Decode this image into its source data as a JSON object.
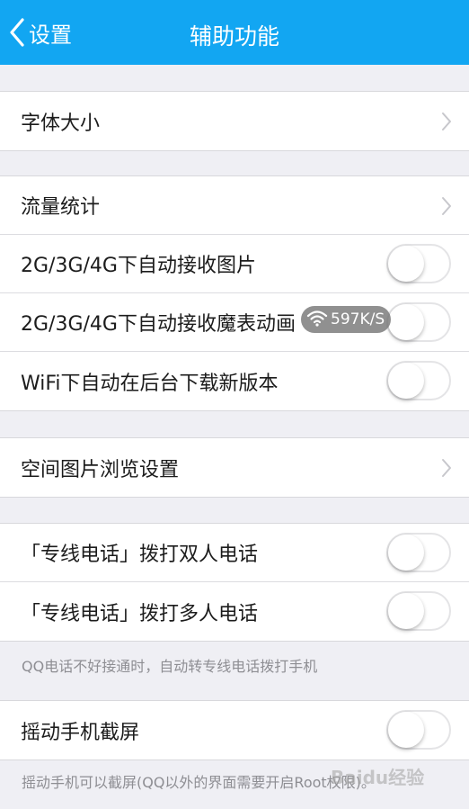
{
  "nav": {
    "back_label": "设置",
    "title": "辅助功能"
  },
  "sections": {
    "font": {
      "items": [
        {
          "label": "字体大小"
        }
      ]
    },
    "data": {
      "items": [
        {
          "label": "流量统计"
        },
        {
          "label": "2G/3G/4G下自动接收图片",
          "toggle": "off"
        },
        {
          "label": "2G/3G/4G下自动接收魔表动画",
          "toggle": "off"
        },
        {
          "label": "WiFi下自动在后台下载新版本",
          "toggle": "off"
        }
      ]
    },
    "space": {
      "items": [
        {
          "label": "空间图片浏览设置"
        }
      ]
    },
    "calls": {
      "items": [
        {
          "label": "「专线电话」拨打双人电话",
          "toggle": "off"
        },
        {
          "label": "「专线电话」拨打多人电话",
          "toggle": "off"
        }
      ],
      "note": "QQ电话不好接通时，自动转专线电话拨打手机"
    },
    "shake": {
      "items": [
        {
          "label": "摇动手机截屏",
          "toggle": "off"
        }
      ],
      "note": "摇动手机可以截屏(QQ以外的界面需要开启Root权限)。"
    }
  },
  "overlay": {
    "network_speed": "597K/S",
    "watermark": "Baidu经验"
  },
  "colors": {
    "nav_bg": "#12a6f2",
    "page_bg": "#efeff4",
    "cell_bg": "#ffffff",
    "note_text": "#8e8e93"
  },
  "icons": {
    "back": "chevron-left-icon",
    "disclosure": "chevron-right-icon",
    "network": "wifi-icon"
  }
}
